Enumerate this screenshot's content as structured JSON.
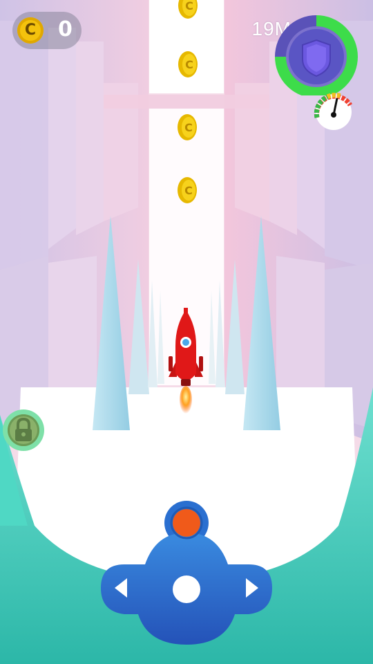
{
  "hud": {
    "coin_count": "0",
    "distance": "19M",
    "shield_icon": "shield-icon",
    "speed_gauge_icon": "speedometer-icon"
  },
  "controls": {
    "left_icon": "arrow-left-icon",
    "right_icon": "arrow-right-icon",
    "boost_icon": "boost-button",
    "center_icon": "center-dot",
    "lock_icon": "locked-ability-icon"
  },
  "colors": {
    "sky": "#ffffff",
    "corridor": "#f4c6dc",
    "spike": "#a9d9ea",
    "rocket": "#e01818",
    "ring_green": "#3ddc4a",
    "controller": "#2e6bd0",
    "boost": "#f05a1a",
    "ground": "#36c9b5"
  }
}
